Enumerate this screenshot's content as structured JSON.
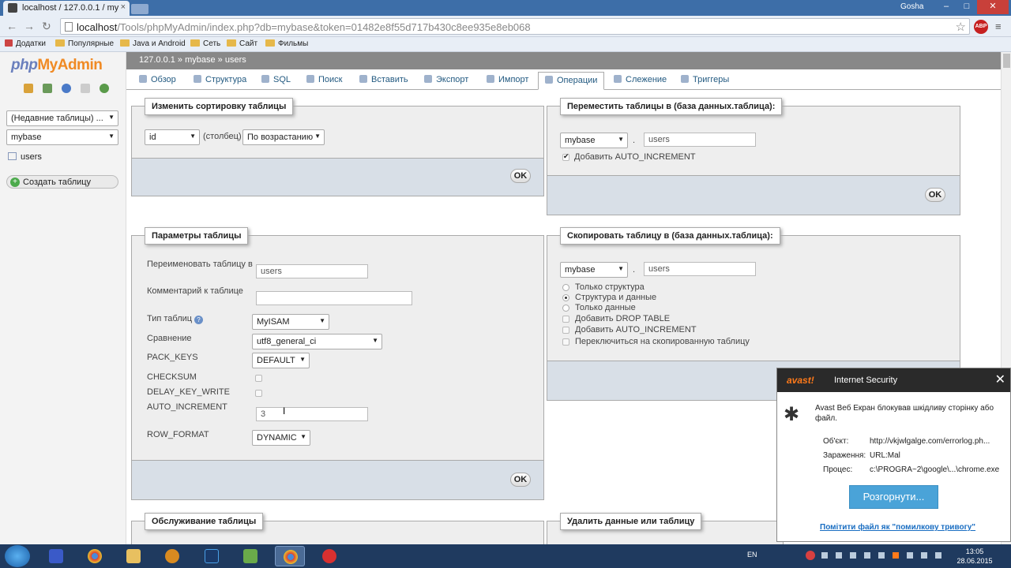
{
  "browser": {
    "tab_title": "localhost / 127.0.0.1 / my",
    "user": "Gosha",
    "url_host": "localhost",
    "url_path": "/Tools/phpMyAdmin/index.php?db=mybase&token=01482e8f55d717b430c8ee935e8eb068",
    "abp": "ABP",
    "bookmarks": [
      "Додатки",
      "Популярные",
      "Java и Android",
      "Сеть",
      "Сайт",
      "Фильмы"
    ]
  },
  "sidebar": {
    "logo_php": "php",
    "logo_my": "MyAdmin",
    "recent_tables": "(Недавние таблицы) ...",
    "database": "mybase",
    "table": "users",
    "create_table": "Создать таблицу"
  },
  "breadcrumb": "127.0.0.1 » mybase » users",
  "tabs": [
    "Обзор",
    "Структура",
    "SQL",
    "Поиск",
    "Вставить",
    "Экспорт",
    "Импорт",
    "Операции",
    "Слежение",
    "Триггеры"
  ],
  "sort": {
    "legend": "Изменить сортировку таблицы",
    "column": "id",
    "column_label": "(столбец)",
    "order": "По возрастанию",
    "ok": "OK"
  },
  "move": {
    "legend": "Переместить таблицы в (база данных.таблица):",
    "db": "mybase",
    "dot": ".",
    "table": "users",
    "auto_increment": "Добавить AUTO_INCREMENT",
    "ok": "OK"
  },
  "params": {
    "legend": "Параметры таблицы",
    "rename_label": "Переименовать таблицу в",
    "rename_value": "users",
    "comment_label": "Комментарий к таблице",
    "comment_value": "",
    "type_label": "Тип таблиц",
    "type_value": "MyISAM",
    "collation_label": "Сравнение",
    "collation_value": "utf8_general_ci",
    "pack_keys_label": "PACK_KEYS",
    "pack_keys_value": "DEFAULT",
    "checksum_label": "CHECKSUM",
    "delay_label": "DELAY_KEY_WRITE",
    "auto_inc_label": "AUTO_INCREMENT",
    "auto_inc_value": "3",
    "row_format_label": "ROW_FORMAT",
    "row_format_value": "DYNAMIC",
    "ok": "OK"
  },
  "copy": {
    "legend": "Скопировать таблицу в (база данных.таблица):",
    "db": "mybase",
    "dot": ".",
    "table": "users",
    "options": [
      "Только структура",
      "Структура и данные",
      "Только данные"
    ],
    "drop_table": "Добавить DROP TABLE",
    "auto_increment": "Добавить AUTO_INCREMENT",
    "switch": "Переключиться на скопированную таблицу"
  },
  "maintenance": {
    "legend": "Обслуживание таблицы"
  },
  "delete": {
    "legend": "Удалить данные или таблицу"
  },
  "avast": {
    "brand": "avast!",
    "product": "Internet Security",
    "message": "Avast Веб Екран блокував шкідливу сторінку або файл.",
    "object_label": "Об'єкт:",
    "object_value": "http://vkjwlgalge.com/errorlog.ph...",
    "infection_label": "Зараження:",
    "infection_value": "URL:Mal",
    "process_label": "Процес:",
    "process_value": "c:\\PROGRA~2\\google\\...\\chrome.exe",
    "expand_button": "Розгорнути...",
    "false_positive": "Помітити файл як \"помилкову тривогу\""
  },
  "taskbar": {
    "lang": "EN",
    "time": "13:05",
    "date": "28.06.2015"
  }
}
